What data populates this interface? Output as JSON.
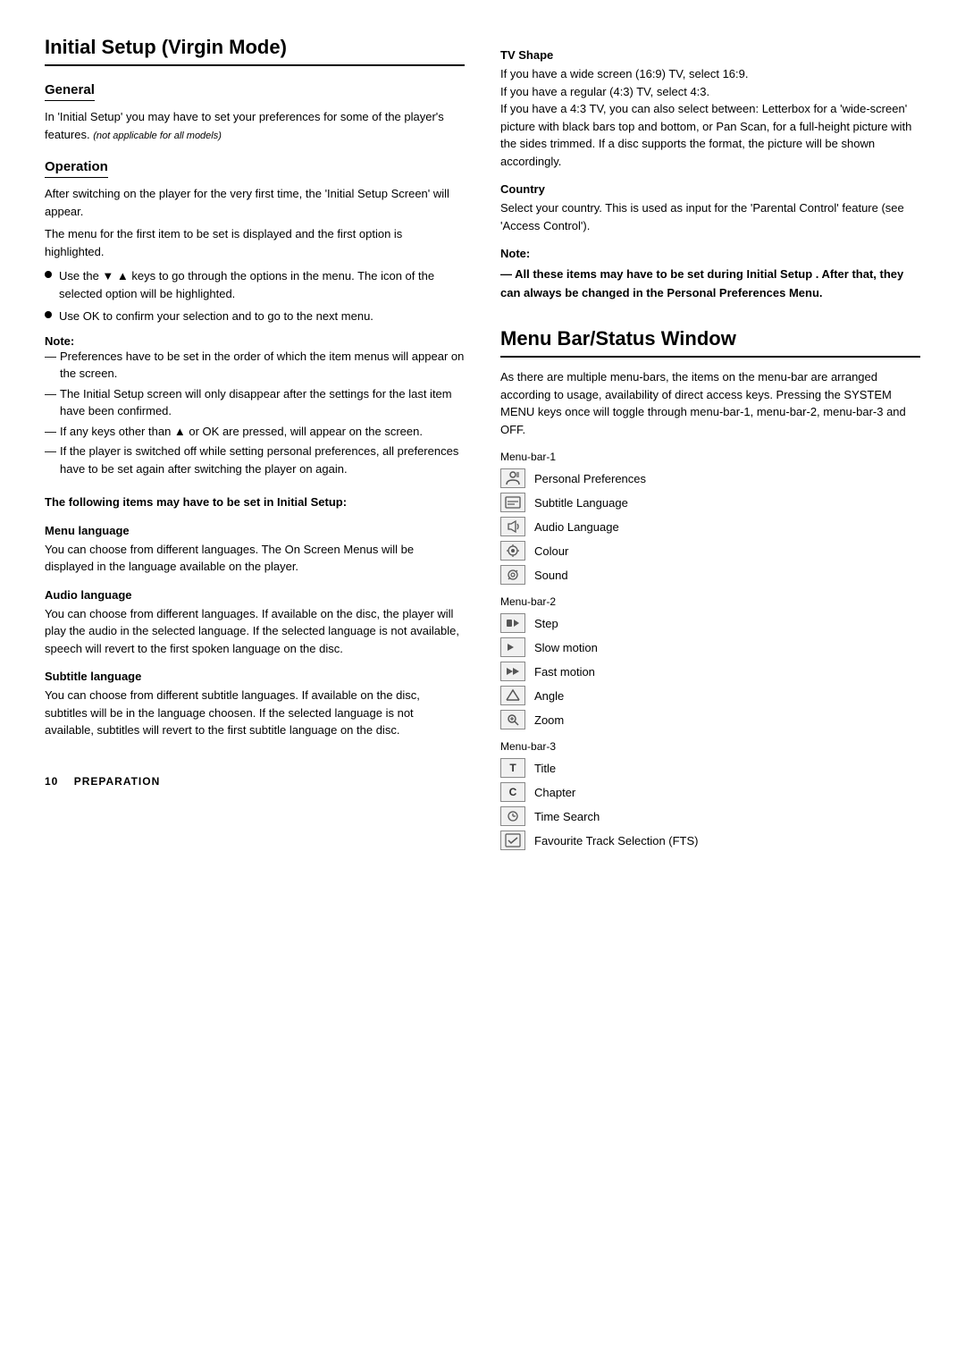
{
  "page": {
    "left": {
      "main_title": "Initial Setup (Virgin Mode)",
      "general": {
        "title": "General",
        "body": "In 'Initial Setup' you may have to set your preferences for some of the player's features.",
        "body_italic": "(not applicable for all models)"
      },
      "operation": {
        "title": "Operation",
        "para1": "After switching on the player for the very first time, the 'Initial Setup Screen' will appear.",
        "para2": "The menu for the first item to be set is displayed and the first option is highlighted.",
        "bullets": [
          "Use the ▼ ▲ keys to go through the options in the menu. The icon of the selected option will be highlighted.",
          "Use OK to confirm your selection and to go to the next menu."
        ],
        "note_label": "Note:",
        "note_items": [
          "Preferences have to be set in the order of which the item menus will appear on the screen.",
          "The  Initial Setup  screen will only disappear after the settings for the last item have been confirmed.",
          "If any keys other than ▲ or OK are pressed, will appear on the screen.",
          "If the player is switched off while setting personal preferences, all preferences have to be set again after switching the player on again."
        ]
      },
      "following_items": {
        "heading": "The following items may have to be set in Initial Setup:",
        "menu_language": {
          "title": "Menu language",
          "body": "You can choose from different languages. The On Screen Menus will be displayed in the language available on the player."
        },
        "audio_language": {
          "title": "Audio language",
          "body": "You can choose from different languages. If available on the disc, the player will play the audio in the selected language. If the selected language is not available, speech will revert to the first spoken language on the disc."
        },
        "subtitle_language": {
          "title": "Subtitle language",
          "body": "You can choose from different subtitle languages. If available on the disc, subtitles will be in the language choosen. If the selected language is not available, subtitles will revert to the first subtitle language on the disc."
        }
      }
    },
    "right": {
      "tv_shape": {
        "title": "TV Shape",
        "body": "If you have a wide screen (16:9) TV, select 16:9.\nIf you have a regular (4:3) TV, select 4:3.\nIf you have a 4:3 TV, you can also select between: Letterbox for a 'wide-screen' picture with black bars top and bottom, or Pan Scan, for a full-height picture with the sides trimmed. If a disc supports the format, the picture will be shown accordingly."
      },
      "country": {
        "title": "Country",
        "body": "Select your country. This is used as input for the 'Parental Control' feature (see 'Access Control')."
      },
      "note": {
        "label": "Note:",
        "body": "— All these items may have to be set during  Initial Setup . After that, they can always be changed in the Personal Preferences Menu."
      },
      "menu_bar_section": {
        "title": "Menu Bar/Status Window",
        "intro": "As there are multiple menu-bars, the items on the menu-bar are arranged according to usage, availability of direct access keys. Pressing the SYSTEM MENU keys once will toggle through menu-bar-1, menu-bar-2, menu-bar-3 and OFF.",
        "bar1": {
          "label": "Menu-bar-1",
          "items": [
            {
              "icon": "person",
              "label": "Personal Preferences"
            },
            {
              "icon": "sub",
              "label": "Subtitle Language"
            },
            {
              "icon": "audio",
              "label": "Audio Language"
            },
            {
              "icon": "colour",
              "label": "Colour"
            },
            {
              "icon": "sound",
              "label": "Sound"
            }
          ]
        },
        "bar2": {
          "label": "Menu-bar-2",
          "items": [
            {
              "icon": "step",
              "label": "Step"
            },
            {
              "icon": "slow",
              "label": "Slow motion"
            },
            {
              "icon": "fast",
              "label": "Fast motion"
            },
            {
              "icon": "angle",
              "label": "Angle"
            },
            {
              "icon": "zoom",
              "label": "Zoom"
            }
          ]
        },
        "bar3": {
          "label": "Menu-bar-3",
          "items": [
            {
              "icon": "T",
              "label": "Title"
            },
            {
              "icon": "C",
              "label": "Chapter"
            },
            {
              "icon": "time",
              "label": "Time Search"
            },
            {
              "icon": "fts",
              "label": "Favourite Track Selection (FTS)"
            }
          ]
        }
      }
    },
    "footer": {
      "page_num": "10",
      "section": "Preparation"
    }
  }
}
